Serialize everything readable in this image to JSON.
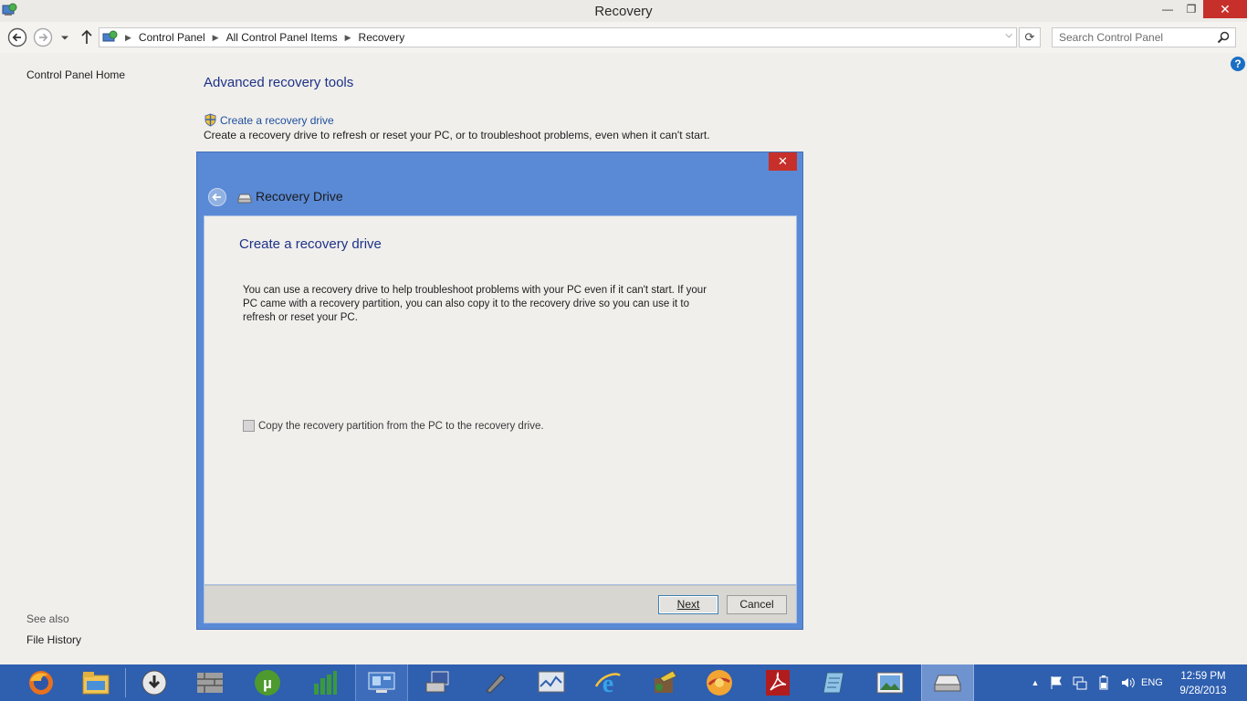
{
  "window": {
    "title": "Recovery"
  },
  "address_bar": {
    "breadcrumbs": [
      "Control Panel",
      "All Control Panel Items",
      "Recovery"
    ],
    "search_placeholder": "Search Control Panel"
  },
  "left_pane": {
    "home_link": "Control Panel Home",
    "see_also_label": "See also",
    "see_also_items": [
      "File History"
    ]
  },
  "main": {
    "heading": "Advanced recovery tools",
    "task_link": "Create a recovery drive",
    "task_description": "Create a recovery drive to refresh or reset your PC, or to troubleshoot problems, even when it can't start."
  },
  "dialog": {
    "title": "Recovery Drive",
    "heading": "Create a recovery drive",
    "body_text": "You can use a recovery drive to help troubleshoot problems with your PC even if it can't start. If your PC came with a recovery partition, you can also copy it to the recovery drive so you can use it to refresh or reset your PC.",
    "checkbox_label": "Copy the recovery partition from the PC to the recovery drive.",
    "checkbox_checked": false,
    "next_label": "Next",
    "cancel_label": "Cancel"
  },
  "taskbar": {
    "apps": [
      "firefox-icon",
      "file-explorer-icon",
      "download-icon",
      "firewall-icon",
      "utorrent-icon",
      "chart-app-icon",
      "control-panel-icon",
      "network-icon",
      "usb-tool-icon",
      "performance-monitor-icon",
      "internet-explorer-icon",
      "setup-icon",
      "browser-orange-icon",
      "adobe-reader-icon",
      "notepad-icon",
      "photo-viewer-icon",
      "recovery-drive-icon"
    ],
    "language": "ENG",
    "time": "12:59 PM",
    "date": "9/28/2013"
  },
  "colors": {
    "heading_blue": "#1e3287",
    "link_blue": "#1f4e9d",
    "dialog_frame": "#5a8ad6",
    "taskbar": "#2f5faf",
    "close_red": "#c7302a"
  }
}
